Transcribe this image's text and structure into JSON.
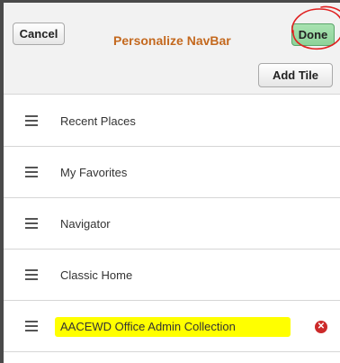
{
  "header": {
    "cancel_label": "Cancel",
    "title": "Personalize NavBar",
    "done_label": "Done",
    "add_tile_label": "Add Tile"
  },
  "tiles": [
    {
      "label": "Recent Places",
      "icon": "drag-handle-icon"
    },
    {
      "label": "My Favorites",
      "icon": "drag-handle-icon"
    },
    {
      "label": "Navigator",
      "icon": "drag-handle-icon"
    },
    {
      "label": "Classic Home",
      "icon": "drag-handle-icon"
    },
    {
      "label": "AACEWD Office Admin Collection",
      "icon": "drag-handle-icon",
      "removable": true,
      "remove_icon": "remove-circle-icon",
      "highlighted": true
    }
  ],
  "colors": {
    "title": "#c4691f",
    "done_button": "#8ed39a",
    "remove_icon": "#cc2a2a",
    "highlight": "#ffff00",
    "annotation_circle": "#e02020"
  }
}
